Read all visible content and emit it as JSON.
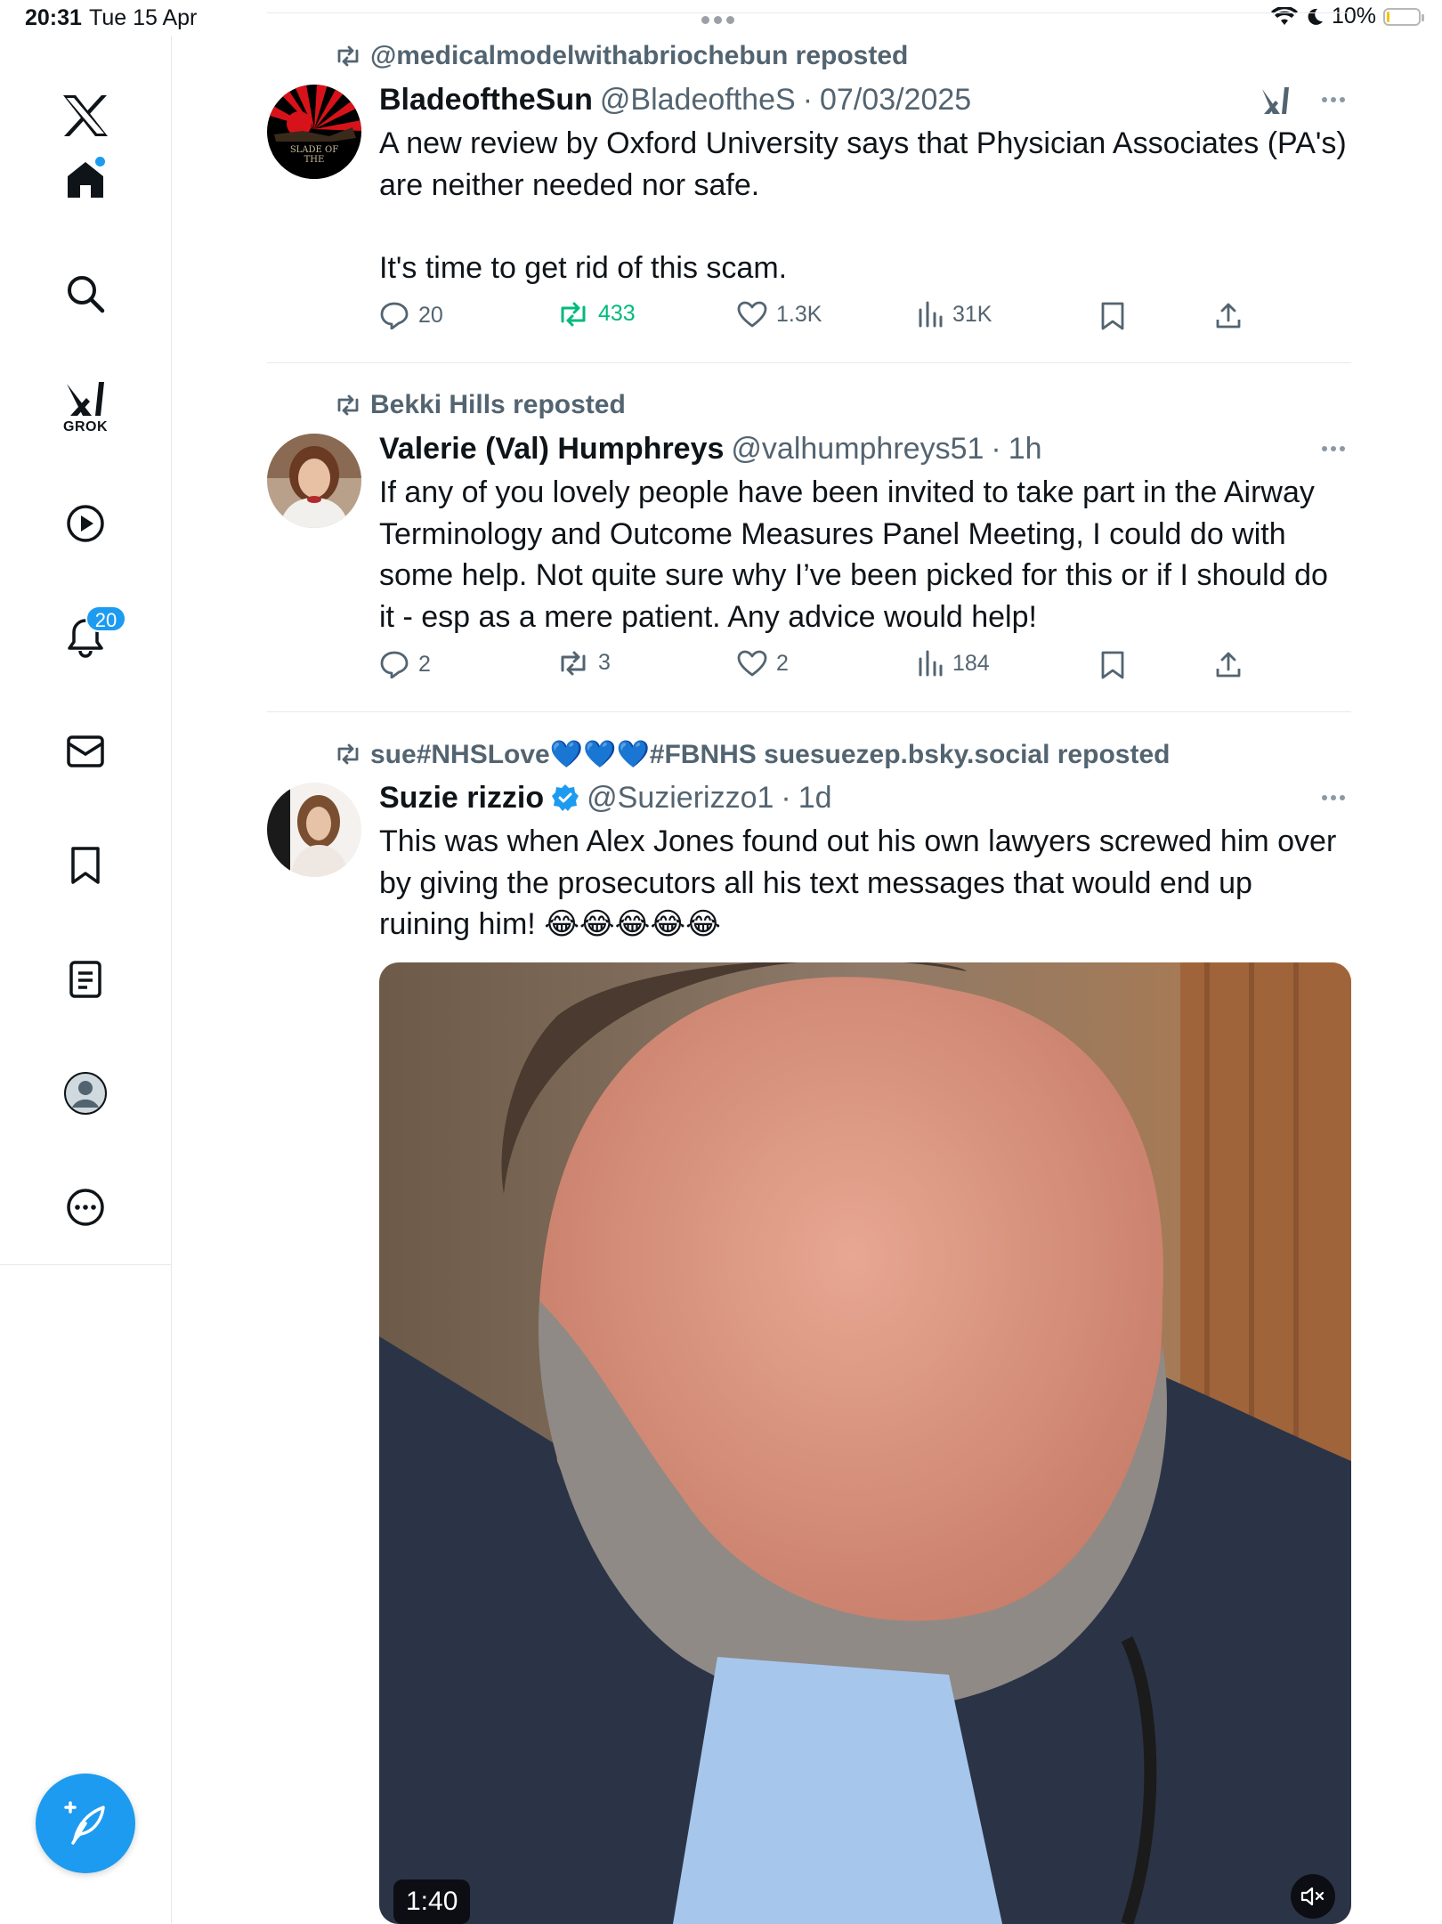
{
  "status_bar": {
    "time": "20:31",
    "date": "Tue 15 Apr",
    "battery": "10%",
    "battery_level": 0.1
  },
  "sidebar": {
    "grok_label": "GROK",
    "notifications_badge": "20"
  },
  "tweets": [
    {
      "reposted_by": "@medicalmodelwithabriochebun reposted",
      "name": "BladeoftheSun",
      "handle": "@BladeoftheS",
      "time": "07/03/2025",
      "body": "A new review by Oxford University says that Physician Associates (PA's) are neither needed nor safe.\n\nIt's time to get rid of this scam.",
      "avatar_text": "SLADE OF THE",
      "replies": "20",
      "reposts": "433",
      "likes": "1.3K",
      "views": "31K"
    },
    {
      "reposted_by": "Bekki Hills reposted",
      "name": "Valerie (Val) Humphreys",
      "handle": "@valhumphreys51",
      "time": "1h",
      "body": "If any of you lovely people have been invited to take part in the Airway Terminology and Outcome Measures Panel Meeting, I could do with some help. Not quite sure why I’ve been picked for this or if I should do it - esp as a mere patient. Any advice would help!",
      "replies": "2",
      "reposts": "3",
      "likes": "2",
      "views": "184"
    },
    {
      "reposted_by": "sue#NHSLove💙💙💙#FBNHS suesuezep.bsky.social reposted",
      "name": "Suzie rizzio",
      "handle": "@Suzierizzo1",
      "time": "1d",
      "body": "This was when Alex Jones found out his own lawyers screwed him over by giving the prosecutors all his text messages that would end up ruining him! 😂😂😂😂😂",
      "video_duration": "1:40"
    }
  ],
  "colors": {
    "accent": "#1d9bf0",
    "repost_active": "#00ba7c",
    "secondary_text": "#536471"
  }
}
